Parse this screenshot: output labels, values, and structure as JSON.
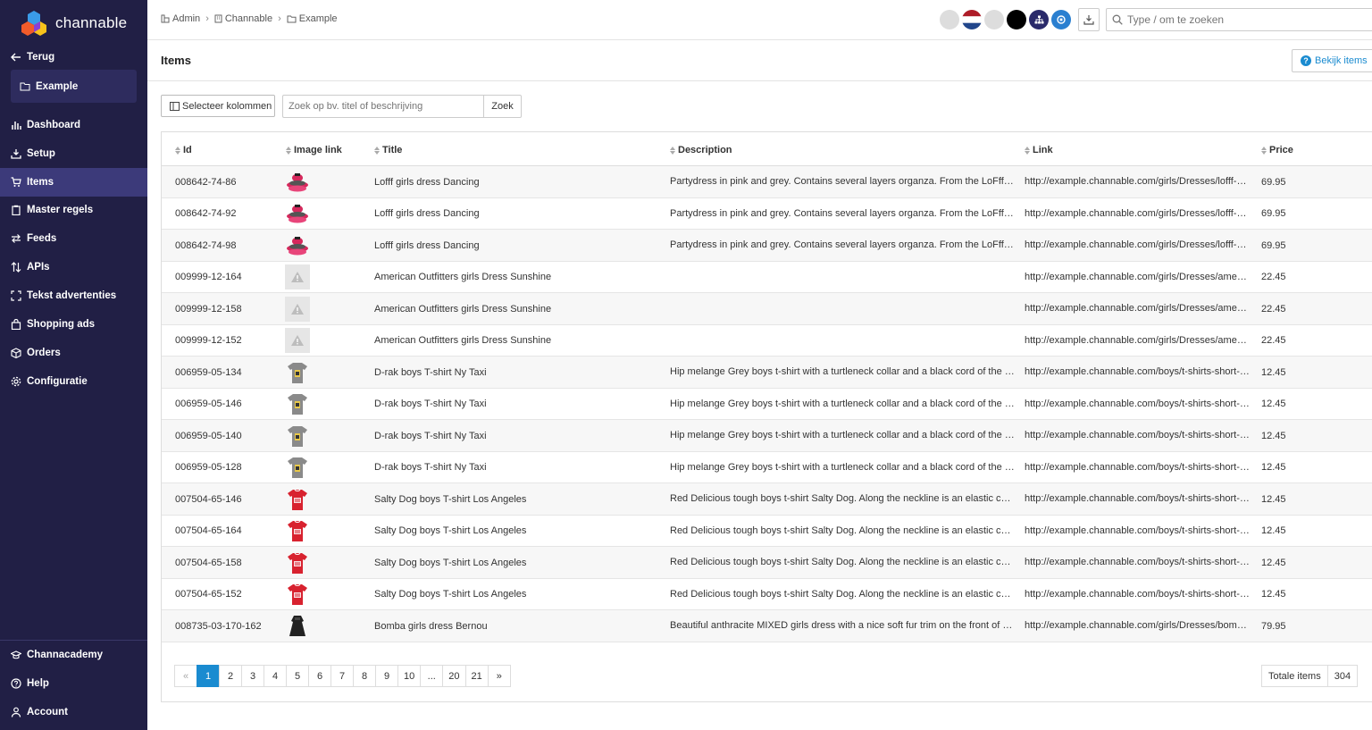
{
  "app": {
    "name": "channable"
  },
  "sidebar": {
    "back_label": "Terug",
    "project": "Example",
    "nav": [
      {
        "label": "Dashboard",
        "icon": "bar-chart-icon"
      },
      {
        "label": "Setup",
        "icon": "download-tray-icon"
      },
      {
        "label": "Items",
        "icon": "cart-icon",
        "active": true
      },
      {
        "label": "Master regels",
        "icon": "clipboard-icon"
      },
      {
        "label": "Feeds",
        "icon": "arrows-icon"
      },
      {
        "label": "APIs",
        "icon": "sort-arrows-icon"
      },
      {
        "label": "Tekst advertenties",
        "icon": "expand-icon"
      },
      {
        "label": "Shopping ads",
        "icon": "bag-icon"
      },
      {
        "label": "Orders",
        "icon": "box-icon"
      },
      {
        "label": "Configuratie",
        "icon": "gear-icon"
      }
    ],
    "bottom": [
      {
        "label": "Channacademy",
        "icon": "graduation-cap-icon"
      },
      {
        "label": "Help",
        "icon": "question-icon"
      },
      {
        "label": "Account",
        "icon": "user-icon"
      }
    ]
  },
  "topbar": {
    "breadcrumb": [
      "Admin",
      "Channable",
      "Example"
    ],
    "search_placeholder": "Type / om te zoeken"
  },
  "page": {
    "title": "Items",
    "bekijk_label": "Bekijk items",
    "select_columns_label": "Selecteer kolommen",
    "search_placeholder": "Zoek op bv. titel of beschrijving",
    "search_button": "Zoek"
  },
  "table": {
    "columns": [
      "Id",
      "Image link",
      "Title",
      "Description",
      "Link",
      "Price"
    ],
    "rows": [
      {
        "id": "008642-74-86",
        "img": "dress-pink",
        "title": "Lofff girls dress Dancing",
        "desc": "Partydress in pink and grey. Contains several layers organza. From the LoFff collection",
        "link": "http://example.channable.com/girls/Dresses/lofff-girls-dress-dancing",
        "price": "69.95"
      },
      {
        "id": "008642-74-92",
        "img": "dress-pink",
        "title": "Lofff girls dress Dancing",
        "desc": "Partydress in pink and grey. Contains several layers organza. From the LoFff collection",
        "link": "http://example.channable.com/girls/Dresses/lofff-girls-dress-dancing",
        "price": "69.95"
      },
      {
        "id": "008642-74-98",
        "img": "dress-pink",
        "title": "Lofff girls dress Dancing",
        "desc": "Partydress in pink and grey. Contains several layers organza. From the LoFff collection",
        "link": "http://example.channable.com/girls/Dresses/lofff-girls-dress-dancing",
        "price": "69.95"
      },
      {
        "id": "009999-12-164",
        "img": "missing",
        "title": "American Outfitters girls Dress Sunshine",
        "desc": "",
        "link": "http://example.channable.com/girls/Dresses/american-outfitters-girls-dress-sunshine",
        "price": "22.45"
      },
      {
        "id": "009999-12-158",
        "img": "missing",
        "title": "American Outfitters girls Dress Sunshine",
        "desc": "",
        "link": "http://example.channable.com/girls/Dresses/american-outfitters-girls-dress-sunshine",
        "price": "22.45"
      },
      {
        "id": "009999-12-152",
        "img": "missing",
        "title": "American Outfitters girls Dress Sunshine",
        "desc": "",
        "link": "http://example.channable.com/girls/Dresses/american-outfitters-girls-dress-sunshine",
        "price": "22.45"
      },
      {
        "id": "006959-05-134",
        "img": "tshirt-grey",
        "title": "D-rak boys T-shirt Ny Taxi",
        "desc": "Hip melange Grey boys t-shirt with a turtleneck collar and a black cord of the D-rak collection",
        "link": "http://example.channable.com/boys/t-shirts-short-sleeve/d-rak-boys-t-shirt-ny-taxi",
        "price": "12.45"
      },
      {
        "id": "006959-05-146",
        "img": "tshirt-grey",
        "title": "D-rak boys T-shirt Ny Taxi",
        "desc": "Hip melange Grey boys t-shirt with a turtleneck collar and a black cord of the D-rak collection",
        "link": "http://example.channable.com/boys/t-shirts-short-sleeve/d-rak-boys-t-shirt-ny-taxi",
        "price": "12.45"
      },
      {
        "id": "006959-05-140",
        "img": "tshirt-grey",
        "title": "D-rak boys T-shirt Ny Taxi",
        "desc": "Hip melange Grey boys t-shirt with a turtleneck collar and a black cord of the D-rak collection",
        "link": "http://example.channable.com/boys/t-shirts-short-sleeve/d-rak-boys-t-shirt-ny-taxi",
        "price": "12.45"
      },
      {
        "id": "006959-05-128",
        "img": "tshirt-grey",
        "title": "D-rak boys T-shirt Ny Taxi",
        "desc": "Hip melange Grey boys t-shirt with a turtleneck collar and a black cord of the D-rak collection",
        "link": "http://example.channable.com/boys/t-shirts-short-sleeve/d-rak-boys-t-shirt-ny-taxi",
        "price": "12.45"
      },
      {
        "id": "007504-65-146",
        "img": "tshirt-red",
        "title": "Salty Dog boys T-shirt Los Angeles",
        "desc": "Red Delicious tough boys t-shirt Salty Dog. Along the neckline is an elastic cord",
        "link": "http://example.channable.com/boys/t-shirts-short-sleeve/salty-dog-boys-t-shirt-los-angeles",
        "price": "12.45"
      },
      {
        "id": "007504-65-164",
        "img": "tshirt-red",
        "title": "Salty Dog boys T-shirt Los Angeles",
        "desc": "Red Delicious tough boys t-shirt Salty Dog. Along the neckline is an elastic cord",
        "link": "http://example.channable.com/boys/t-shirts-short-sleeve/salty-dog-boys-t-shirt-los-angeles",
        "price": "12.45"
      },
      {
        "id": "007504-65-158",
        "img": "tshirt-red",
        "title": "Salty Dog boys T-shirt Los Angeles",
        "desc": "Red Delicious tough boys t-shirt Salty Dog. Along the neckline is an elastic cord",
        "link": "http://example.channable.com/boys/t-shirts-short-sleeve/salty-dog-boys-t-shirt-los-angeles",
        "price": "12.45"
      },
      {
        "id": "007504-65-152",
        "img": "tshirt-red",
        "title": "Salty Dog boys T-shirt Los Angeles",
        "desc": "Red Delicious tough boys t-shirt Salty Dog. Along the neckline is an elastic cord",
        "link": "http://example.channable.com/boys/t-shirts-short-sleeve/salty-dog-boys-t-shirt-los-angeles",
        "price": "12.45"
      },
      {
        "id": "008735-03-170-162",
        "img": "dress-black",
        "title": "Bomba girls dress Bernou",
        "desc": "Beautiful anthracite MIXED girls dress with a nice soft fur trim on the front of the dress",
        "link": "http://example.channable.com/girls/Dresses/bomba-girls-dress-bernou",
        "price": "79.95"
      }
    ]
  },
  "pagination": {
    "prev": "«",
    "pages": [
      "1",
      "2",
      "3",
      "4",
      "5",
      "6",
      "7",
      "8",
      "9",
      "10",
      "...",
      "20",
      "21"
    ],
    "next": "»",
    "current": "1",
    "total_label": "Totale items",
    "total": "304"
  },
  "colors": {
    "sidebar_bg": "#211f45",
    "sidebar_active": "#3c3a7a",
    "accent": "#1a8bd0"
  }
}
